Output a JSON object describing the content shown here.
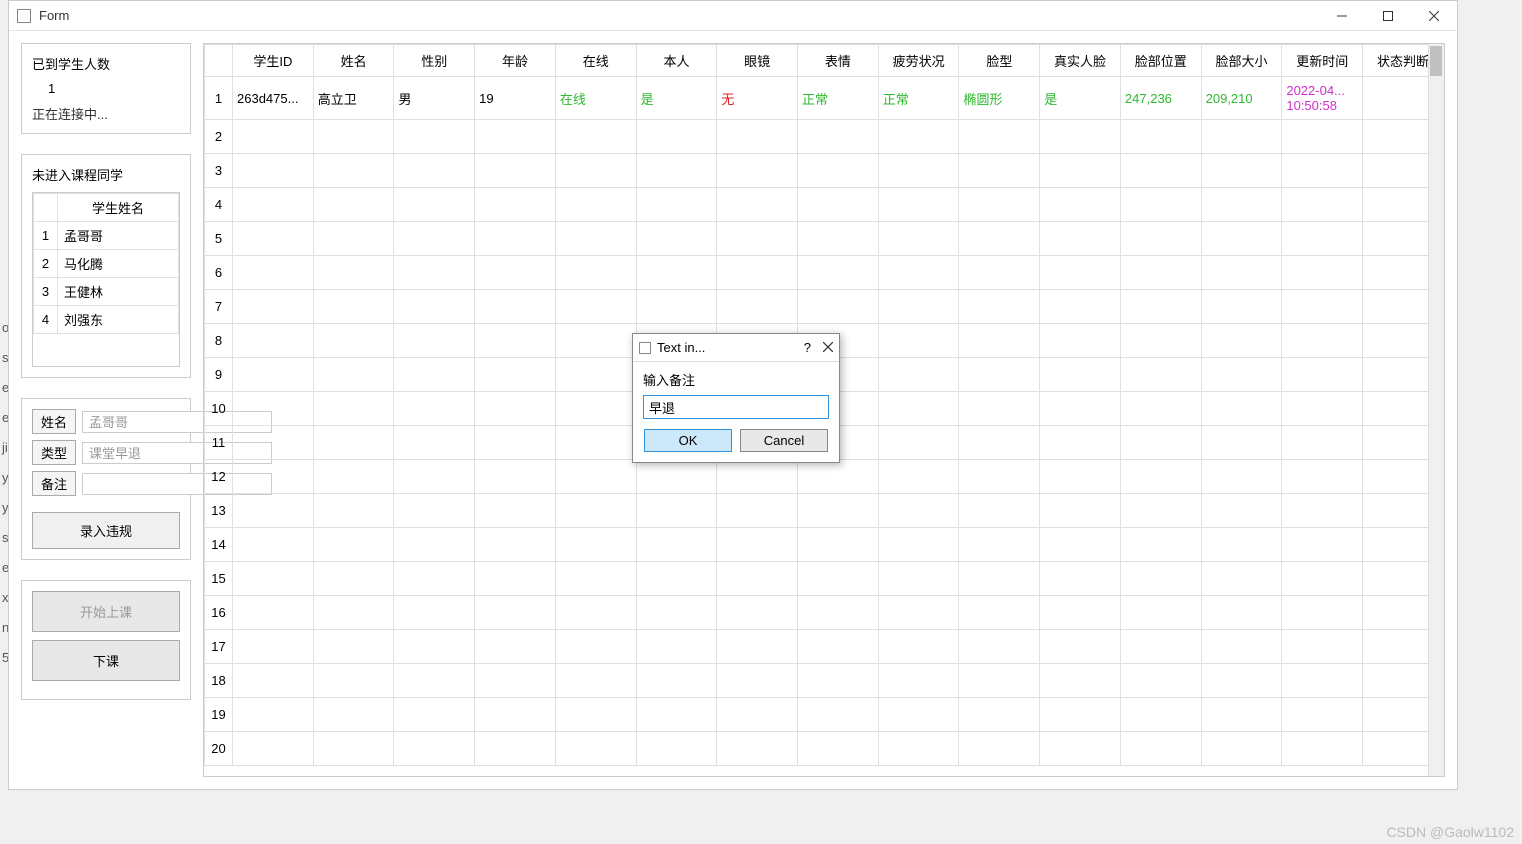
{
  "window": {
    "title": "Form"
  },
  "sidebar": {
    "arrived": {
      "label": "已到学生人数",
      "count": "1",
      "status": "正在连接中..."
    },
    "not_entered": {
      "title": "未进入课程同学",
      "header": "学生姓名",
      "students": [
        "孟哥哥",
        "马化腾",
        "王健林",
        "刘强东"
      ]
    },
    "form": {
      "name_label": "姓名",
      "name_value": "孟哥哥",
      "type_label": "类型",
      "type_value": "课堂早退",
      "remark_label": "备注",
      "remark_value": "",
      "submit": "录入违规"
    },
    "actions": {
      "start": "开始上课",
      "end": "下课"
    }
  },
  "main_table": {
    "headers": [
      "学生ID",
      "姓名",
      "性别",
      "年龄",
      "在线",
      "本人",
      "眼镜",
      "表情",
      "疲劳状况",
      "脸型",
      "真实人脸",
      "脸部位置",
      "脸部大小",
      "更新时间",
      "状态判断"
    ],
    "row1": {
      "id": "263d475...",
      "name": "高立卫",
      "gender": "男",
      "age": "19",
      "online": "在线",
      "self": "是",
      "glasses": "无",
      "expression": "正常",
      "fatigue": "正常",
      "face_shape": "椭圆形",
      "real_face": "是",
      "face_pos": "247,236",
      "face_size": "209,210",
      "update_time_1": "2022-04...",
      "update_time_2": "10:50:58",
      "status": ""
    },
    "row_count": 20
  },
  "dialog": {
    "title": "Text in...",
    "label": "输入备注",
    "value": "早退",
    "ok": "OK",
    "cancel": "Cancel"
  },
  "watermark": "CSDN @Gaolw1102",
  "left_fragments": [
    "",
    "",
    "",
    "",
    "",
    "",
    "",
    "",
    "",
    "",
    "",
    "o",
    "s",
    "et",
    "e",
    "ji",
    "y",
    "",
    "y",
    "",
    "s.",
    "e",
    "",
    "x",
    "n",
    "5"
  ]
}
